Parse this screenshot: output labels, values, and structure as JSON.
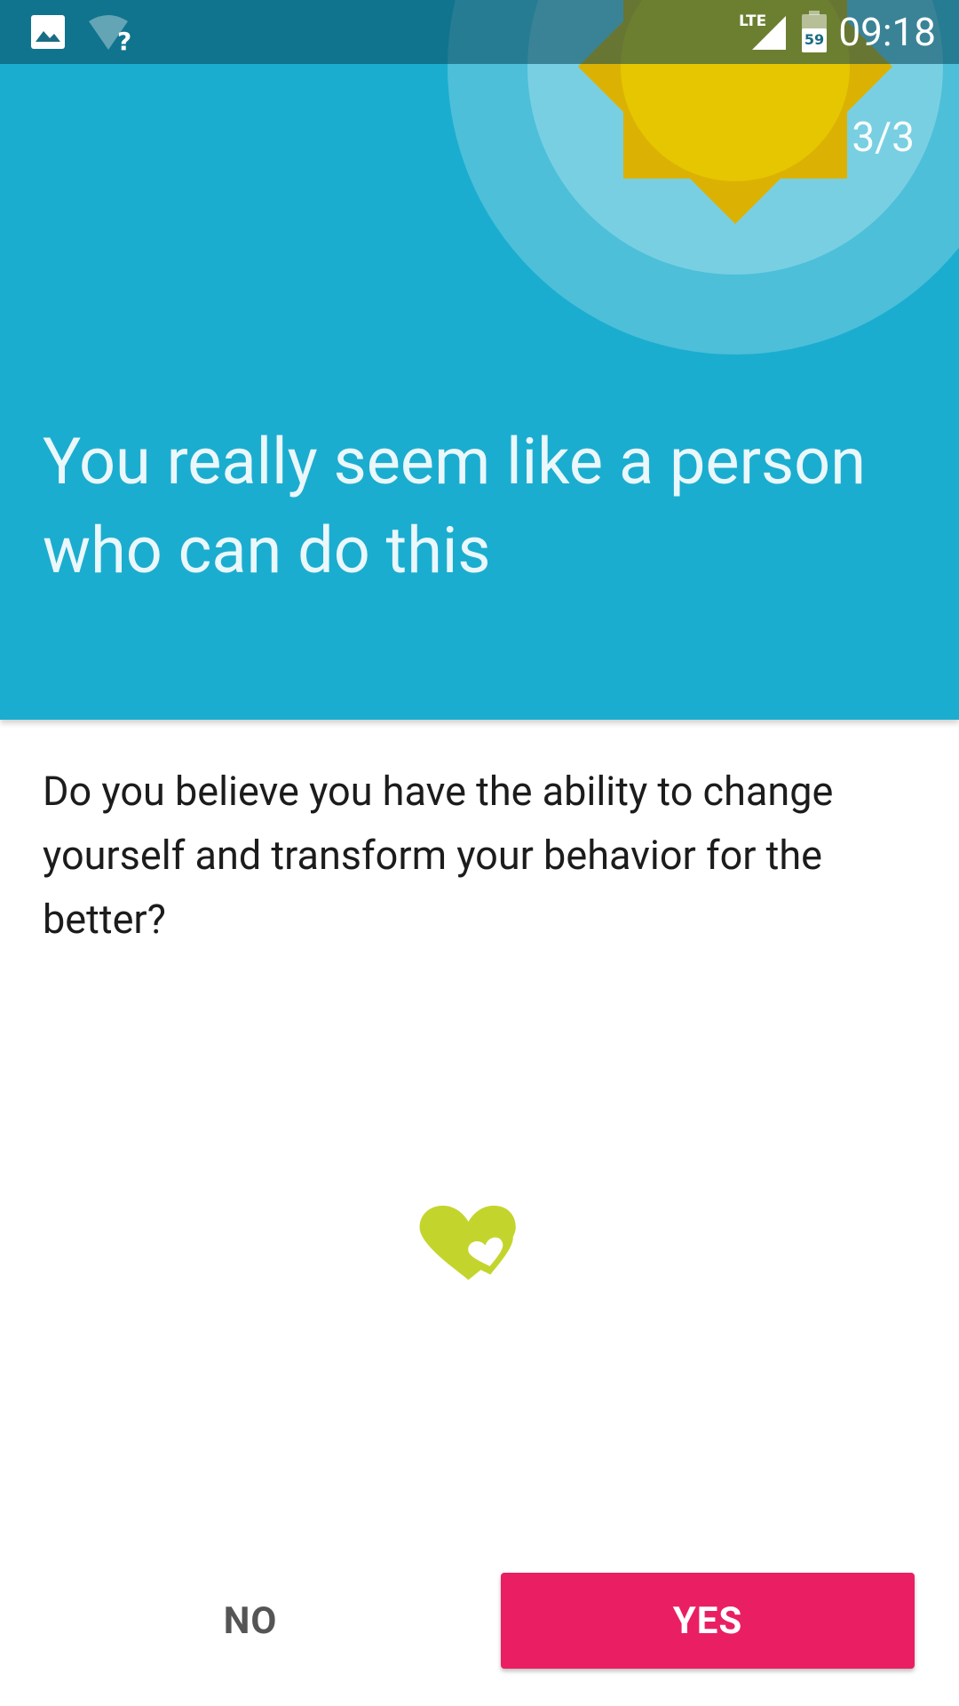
{
  "status_bar": {
    "time": "09:18",
    "battery_level": "59",
    "network_type": "LTE",
    "icons": [
      "image-notification-icon",
      "wifi-unknown-icon",
      "lte-signal-icon",
      "battery-icon"
    ]
  },
  "header": {
    "page_indicator": "3/3",
    "headline": "You really seem like a person who can do this",
    "background_color": "#1badcf"
  },
  "content": {
    "question": "Do you believe you have the ability to change yourself and transform your behavior for the better?",
    "illustration": "hearts-icon",
    "illustration_color": "#c3d52d"
  },
  "actions": {
    "no_label": "NO",
    "yes_label": "YES",
    "yes_color": "#ea1f63"
  }
}
